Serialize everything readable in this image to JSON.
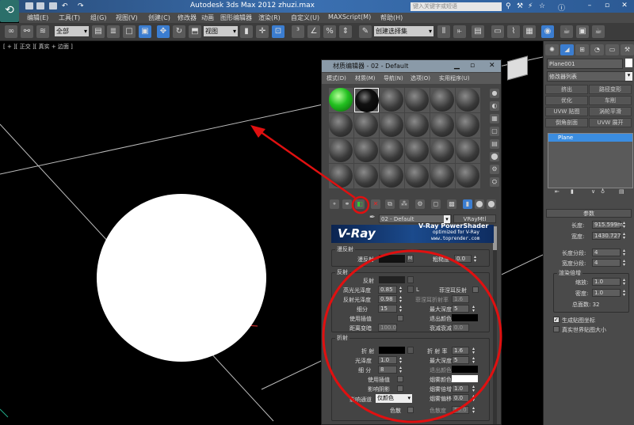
{
  "window": {
    "title": "Autodesk 3ds Max  2012  zhuzi.max",
    "search_placeholder": "键入关键字或短语"
  },
  "menu": [
    "编辑(E)",
    "工具(T)",
    "组(G)",
    "视图(V)",
    "创建(C)",
    "修改器",
    "动画",
    "图形编辑器",
    "渲染(R)",
    "自定义(U)",
    "MAXScript(M)",
    "帮助(H)"
  ],
  "toolbar": {
    "selection_filter": "全部",
    "coord_system": "视图",
    "named_selection": "创建选择集"
  },
  "viewport": {
    "label": "[ + ][ 正交 ][ 真实 + 边面 ]"
  },
  "material_editor": {
    "title": "材质编辑器 - 02 - Default",
    "menu": [
      "模式(D)",
      "材质(M)",
      "导航(N)",
      "选项(O)",
      "实用程序(U)"
    ],
    "material_name": "02 - Default",
    "material_type": "VRayMtl",
    "banner": {
      "logo": "V-Ray",
      "title": "V-Ray PowerShader",
      "subtitle": "optimized for V-Ray",
      "site": "www.toprender.com"
    },
    "slots": [
      "green",
      "black",
      "gray",
      "gray",
      "gray",
      "gray",
      "gray",
      "gray",
      "gray",
      "gray",
      "gray",
      "gray",
      "gray",
      "gray",
      "gray",
      "gray",
      "gray",
      "gray",
      "gray",
      "gray",
      "gray",
      "gray",
      "gray",
      "gray"
    ],
    "diffuse": {
      "section": "漫反射",
      "diffuse_label": "漫反射",
      "map_button": "M",
      "roughness_label": "粗糙度",
      "roughness": "0.0"
    },
    "reflection": {
      "section": "反射",
      "reflect": "反射",
      "hilight_gloss_label": "高光光泽度",
      "hilight_gloss": "0.85",
      "refl_gloss_label": "反射光泽度",
      "refl_gloss": "0.98",
      "subdivs_label": "细分",
      "subdivs": "15",
      "use_interp": "使用插值",
      "max_dist_label": "距离变暗",
      "max_dist": "100.0",
      "lock": "L",
      "fresnel_label": "菲涅耳反射",
      "fresnel_ior_label": "菲涅耳折射率",
      "fresnel_ior": "1.6",
      "max_depth_label": "最大深度",
      "max_depth": "5",
      "exit_color": "退出颜色",
      "dim_falloff_label": "衰减衰减",
      "dim_falloff": "0.0"
    },
    "refraction": {
      "section": "折射",
      "refract": "折 射",
      "gloss_label": "光泽度",
      "gloss": "1.0",
      "subdivs_label": "细 分",
      "subdivs": "8",
      "use_interp": "使用插值",
      "affect_shadows": "影响阴影",
      "affect_channels_label": "影响通道",
      "affect_channels": "仅颜色",
      "dispersion": "色散",
      "ior_label": "折 射 率",
      "ior": "1.6",
      "max_depth_label": "最大深度",
      "max_depth": "5",
      "exit_color": "退出颜色",
      "fog_color": "烟雾颜色",
      "fog_mult_label": "烟雾倍增",
      "fog_mult": "1.0",
      "fog_bias_label": "烟雾偏移",
      "fog_bias": "0.0",
      "abbe_label": "色散度",
      "abbe": "50.0"
    }
  },
  "command_panel": {
    "object_name": "Plane001",
    "modifier_list": "修改器列表",
    "buttons": [
      "挤出",
      "路径变形",
      "优化",
      "车削",
      "UVW 贴图",
      "涡轮平滑",
      "倒角剖面",
      "UVW 展开"
    ],
    "stack": [
      "Plane"
    ],
    "params": {
      "title": "参数",
      "length_label": "长度:",
      "length": "915.599m",
      "width_label": "宽度:",
      "width": "1430.727",
      "length_segs_label": "长度分段:",
      "length_segs": "4",
      "width_segs_label": "宽度分段:",
      "width_segs": "4",
      "render_mult": "渲染倍增",
      "scale_label": "缩放:",
      "scale": "1.0",
      "density_label": "密度:",
      "density": "1.0",
      "total_faces": "总面数: 32",
      "gen_coords": "生成贴图坐标",
      "gen_coords_checked": true,
      "real_world": "真实世界贴图大小",
      "real_world_checked": false
    }
  },
  "colors": {
    "annotation": "#e01010",
    "accent": "#3b7dd0"
  }
}
